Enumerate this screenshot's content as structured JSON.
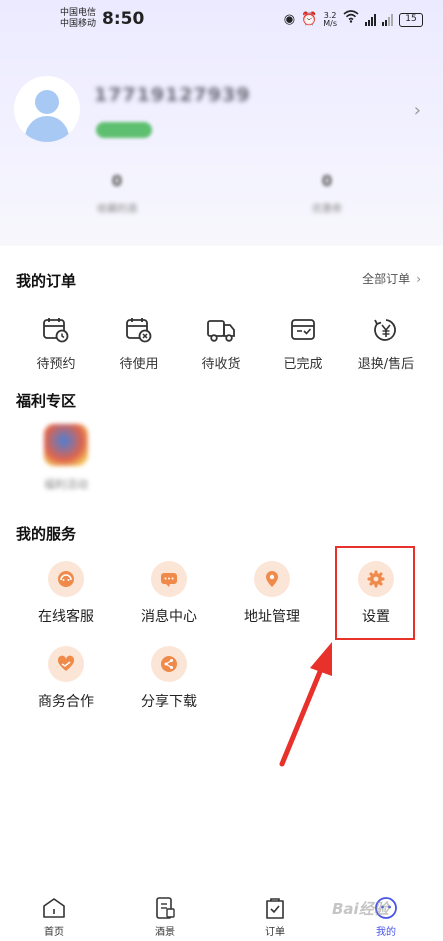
{
  "status_bar": {
    "carrier_1": "中国电信",
    "carrier_2": "中国移动",
    "time": "8:50",
    "net_speed_value": "3.2",
    "net_speed_unit": "M/s",
    "battery": "15"
  },
  "profile": {
    "phone": "17719127939",
    "stats": [
      {
        "value": "0",
        "label": "收藏的酒"
      },
      {
        "value": "0",
        "label": "优惠券"
      }
    ]
  },
  "orders": {
    "title": "我的订单",
    "all_orders_label": "全部订单",
    "items": [
      {
        "label": "待预约",
        "icon": "calendar-clock-icon"
      },
      {
        "label": "待使用",
        "icon": "calendar-x-icon"
      },
      {
        "label": "待收货",
        "icon": "truck-icon"
      },
      {
        "label": "已完成",
        "icon": "wallet-check-icon"
      },
      {
        "label": "退换/售后",
        "icon": "yuan-refund-icon"
      }
    ]
  },
  "welfare": {
    "title": "福利专区",
    "item_label": "福利活动"
  },
  "services": {
    "title": "我的服务",
    "items": [
      {
        "label": "在线客服",
        "icon": "customer-service-icon"
      },
      {
        "label": "消息中心",
        "icon": "message-icon"
      },
      {
        "label": "地址管理",
        "icon": "location-pin-icon"
      },
      {
        "label": "设置",
        "icon": "gear-icon"
      },
      {
        "label": "商务合作",
        "icon": "heart-hand-icon"
      },
      {
        "label": "分享下载",
        "icon": "share-icon"
      }
    ]
  },
  "bottom_nav": {
    "items": [
      {
        "label": "首页",
        "icon": "home-icon",
        "active": false
      },
      {
        "label": "酒景",
        "icon": "scenery-icon",
        "active": false
      },
      {
        "label": "订单",
        "icon": "order-bag-icon",
        "active": false
      },
      {
        "label": "我的",
        "icon": "profile-icon",
        "active": true
      }
    ]
  },
  "watermark": "Bai经验",
  "colors": {
    "accent_orange": "#f08a4b",
    "service_icon_bg": "#fbe5d6",
    "annotation_red": "#e8312b",
    "nav_active": "#4a55e8"
  }
}
